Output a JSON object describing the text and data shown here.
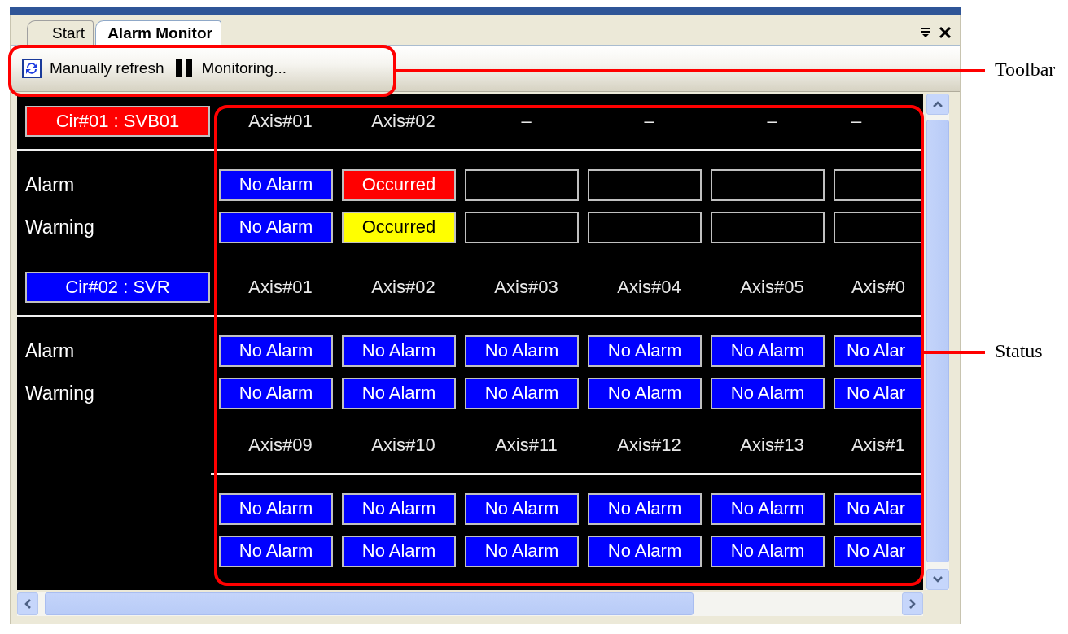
{
  "tabs": [
    {
      "label": "Start",
      "selected": false
    },
    {
      "label": "Alarm Monitor",
      "selected": true
    }
  ],
  "toolbar": {
    "items": [
      {
        "kind": "refresh",
        "label": "Manually refresh"
      },
      {
        "kind": "pause",
        "label": "Monitoring..."
      }
    ]
  },
  "circuits": [
    {
      "label": "Cir#01 : SVB01",
      "color": "#ff0000",
      "groups": [
        {
          "axes": [
            "Axis#01",
            "Axis#02",
            "–",
            "–",
            "–",
            "–"
          ],
          "rows": [
            {
              "label": "Alarm",
              "cells": [
                {
                  "kind": "ok",
                  "text": "No Alarm"
                },
                {
                  "kind": "alarm",
                  "text": "Occurred"
                },
                {
                  "kind": "empty"
                },
                {
                  "kind": "empty"
                },
                {
                  "kind": "empty"
                },
                {
                  "kind": "empty"
                }
              ]
            },
            {
              "label": "Warning",
              "cells": [
                {
                  "kind": "ok",
                  "text": "No Alarm"
                },
                {
                  "kind": "warning",
                  "text": "Occurred"
                },
                {
                  "kind": "empty"
                },
                {
                  "kind": "empty"
                },
                {
                  "kind": "empty"
                },
                {
                  "kind": "empty"
                }
              ]
            }
          ]
        }
      ]
    },
    {
      "label": "Cir#02 : SVR",
      "color": "#0000ff",
      "groups": [
        {
          "axes": [
            "Axis#01",
            "Axis#02",
            "Axis#03",
            "Axis#04",
            "Axis#05",
            "Axis#0"
          ],
          "rows": [
            {
              "label": "Alarm",
              "cells": [
                {
                  "kind": "ok",
                  "text": "No Alarm"
                },
                {
                  "kind": "ok",
                  "text": "No Alarm"
                },
                {
                  "kind": "ok",
                  "text": "No Alarm"
                },
                {
                  "kind": "ok",
                  "text": "No Alarm"
                },
                {
                  "kind": "ok",
                  "text": "No Alarm"
                },
                {
                  "kind": "ok",
                  "text": "No Alar"
                }
              ]
            },
            {
              "label": "Warning",
              "cells": [
                {
                  "kind": "ok",
                  "text": "No Alarm"
                },
                {
                  "kind": "ok",
                  "text": "No Alarm"
                },
                {
                  "kind": "ok",
                  "text": "No Alarm"
                },
                {
                  "kind": "ok",
                  "text": "No Alarm"
                },
                {
                  "kind": "ok",
                  "text": "No Alarm"
                },
                {
                  "kind": "ok",
                  "text": "No Alar"
                }
              ]
            }
          ]
        },
        {
          "axes": [
            "Axis#09",
            "Axis#10",
            "Axis#11",
            "Axis#12",
            "Axis#13",
            "Axis#1"
          ],
          "rows": [
            {
              "cells": [
                {
                  "kind": "ok",
                  "text": "No Alarm"
                },
                {
                  "kind": "ok",
                  "text": "No Alarm"
                },
                {
                  "kind": "ok",
                  "text": "No Alarm"
                },
                {
                  "kind": "ok",
                  "text": "No Alarm"
                },
                {
                  "kind": "ok",
                  "text": "No Alarm"
                },
                {
                  "kind": "ok",
                  "text": "No Alar"
                }
              ]
            },
            {
              "cells": [
                {
                  "kind": "ok",
                  "text": "No Alarm"
                },
                {
                  "kind": "ok",
                  "text": "No Alarm"
                },
                {
                  "kind": "ok",
                  "text": "No Alarm"
                },
                {
                  "kind": "ok",
                  "text": "No Alarm"
                },
                {
                  "kind": "ok",
                  "text": "No Alarm"
                },
                {
                  "kind": "ok",
                  "text": "No Alar"
                }
              ]
            }
          ]
        }
      ]
    }
  ],
  "annotations": [
    {
      "kind": "toolbar",
      "label": "Toolbar"
    },
    {
      "kind": "status",
      "label": "Status"
    }
  ]
}
